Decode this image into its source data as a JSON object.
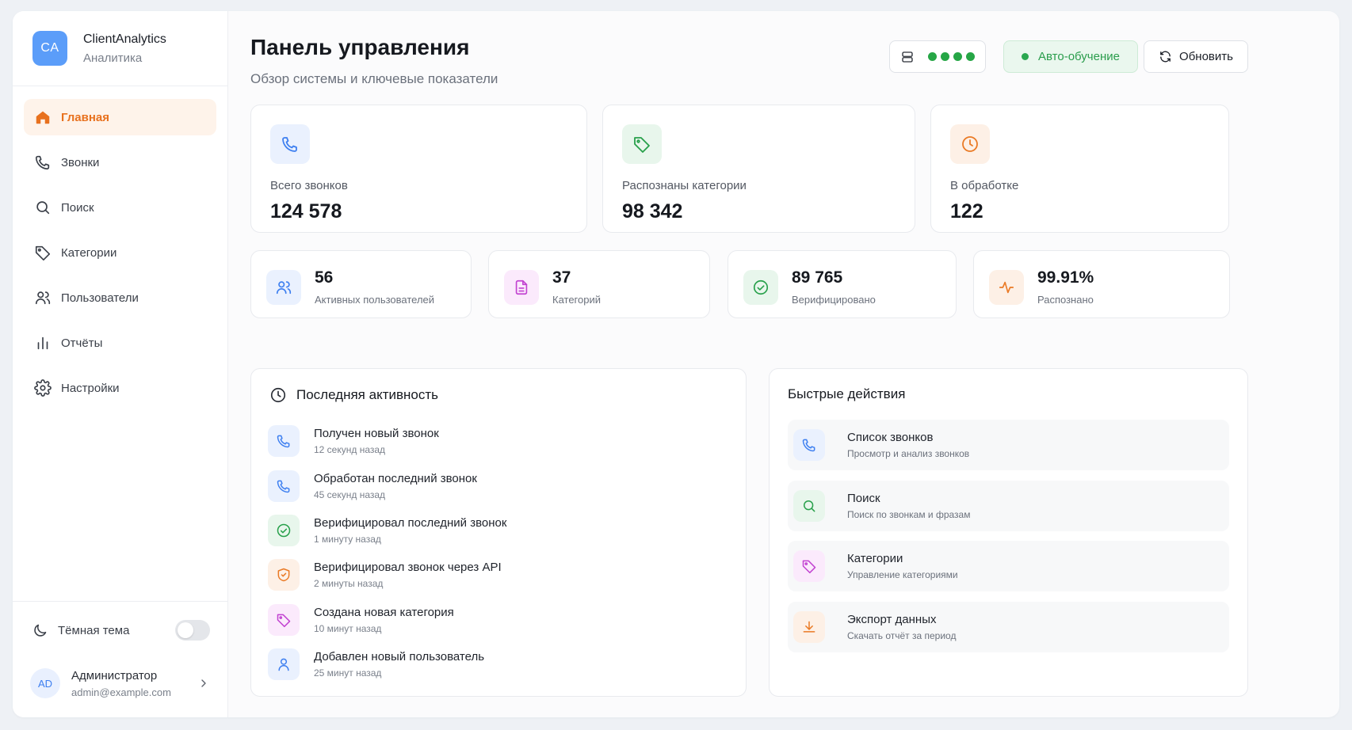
{
  "brand": {
    "logo": "CA",
    "name": "ClientAnalytics",
    "subtitle": "Аналитика"
  },
  "nav": [
    {
      "label": "Главная",
      "icon": "home-icon",
      "active": true
    },
    {
      "label": "Звонки",
      "icon": "phone-icon"
    },
    {
      "label": "Поиск",
      "icon": "search-icon"
    },
    {
      "label": "Категории",
      "icon": "tag-icon"
    },
    {
      "label": "Пользователи",
      "icon": "users-icon"
    },
    {
      "label": "Отчёты",
      "icon": "bar-chart-icon"
    },
    {
      "label": "Настройки",
      "icon": "gear-icon"
    }
  ],
  "theme": {
    "label": "Тёмная тема",
    "enabled": false
  },
  "user": {
    "initials": "AD",
    "name": "Администратор",
    "email": "admin@example.com"
  },
  "header": {
    "title": "Панель управления",
    "subtitle": "Обзор системы и ключевые показатели",
    "auto_label": "Авто-обучение",
    "refresh_label": "Обновить"
  },
  "stats_big": [
    {
      "label": "Всего звонков",
      "value": "124 578",
      "icon": "phone-icon",
      "color": "#3d7ff0",
      "bg": "#eaf1fe"
    },
    {
      "label": "Распознаны категории",
      "value": "98 342",
      "icon": "tag-icon",
      "color": "#27a04a",
      "bg": "#e8f6ec"
    },
    {
      "label": "В обработке",
      "value": "122",
      "icon": "clock-icon",
      "color": "#ea7a25",
      "bg": "#fdf0e6"
    }
  ],
  "stats_small": [
    {
      "value": "56",
      "label": "Активных пользователей",
      "icon": "users-icon",
      "color": "#3d7ff0",
      "bg": "#eaf1fe"
    },
    {
      "value": "37",
      "label": "Категорий",
      "icon": "document-icon",
      "color": "#c243d1",
      "bg": "#fbeafc"
    },
    {
      "value": "89 765",
      "label": "Верифицировано",
      "icon": "check-circle-icon",
      "color": "#27a04a",
      "bg": "#e8f6ec"
    },
    {
      "value": "99.91%",
      "label": "Распознано",
      "icon": "activity-icon",
      "color": "#ea7a25",
      "bg": "#fdf0e6"
    }
  ],
  "activity": {
    "title": "Последняя активность",
    "items": [
      {
        "title": "Получен новый звонок",
        "time": "12 секунд назад",
        "icon": "phone-icon",
        "color": "#3d7ff0",
        "bg": "#eaf1fe"
      },
      {
        "title": "Обработан последний звонок",
        "time": "45 секунд назад",
        "icon": "phone-icon",
        "color": "#3d7ff0",
        "bg": "#eaf1fe"
      },
      {
        "title": "Верифицировал последний звонок",
        "time": "1 минуту назад",
        "icon": "check-circle-icon",
        "color": "#27a04a",
        "bg": "#e8f6ec"
      },
      {
        "title": "Верифицировал звонок через API",
        "time": "2 минуты назад",
        "icon": "shield-check-icon",
        "color": "#ea7a25",
        "bg": "#fdf0e6"
      },
      {
        "title": "Создана новая категория",
        "time": "10 минут назад",
        "icon": "tag-icon",
        "color": "#c243d1",
        "bg": "#fbeafc"
      },
      {
        "title": "Добавлен новый пользователь",
        "time": "25 минут назад",
        "icon": "user-icon",
        "color": "#3d7ff0",
        "bg": "#eaf1fe"
      }
    ]
  },
  "quick": {
    "title": "Быстрые действия",
    "items": [
      {
        "title": "Список звонков",
        "sub": "Просмотр и анализ звонков",
        "icon": "phone-icon",
        "color": "#3d7ff0",
        "bg": "#eaf1fe"
      },
      {
        "title": "Поиск",
        "sub": "Поиск по звонкам и фразам",
        "icon": "search-icon",
        "color": "#27a04a",
        "bg": "#e8f6ec"
      },
      {
        "title": "Категории",
        "sub": "Управление категориями",
        "icon": "tag-icon",
        "color": "#c243d1",
        "bg": "#fbeafc"
      },
      {
        "title": "Экспорт данных",
        "sub": "Скачать отчёт за период",
        "icon": "download-icon",
        "color": "#ea7a25",
        "bg": "#fdf0e6"
      }
    ]
  }
}
